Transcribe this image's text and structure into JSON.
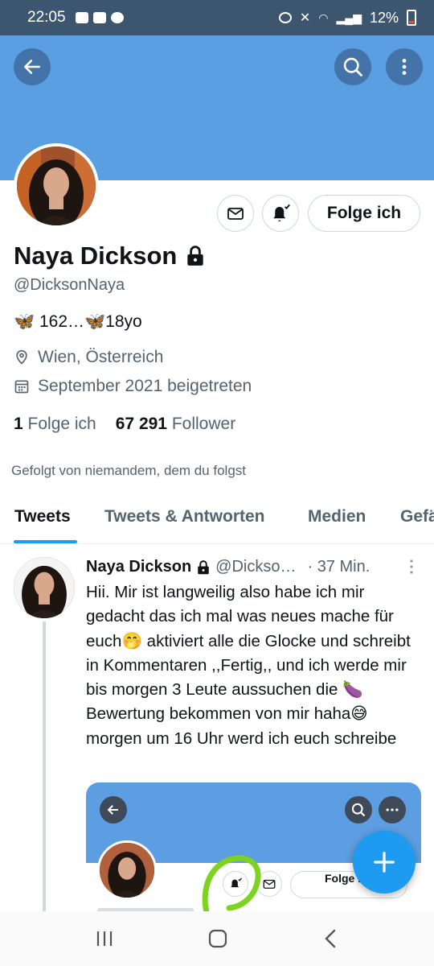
{
  "status_bar": {
    "time": "22:05",
    "battery": "12%"
  },
  "header": {
    "back_icon": "arrow-left-icon",
    "search_icon": "search-icon",
    "more_icon": "more-vertical-icon",
    "banner_color": "#5b9fe3"
  },
  "profile": {
    "name": "Naya Dickson",
    "handle": "@DicksonNaya",
    "bio": "🦋 162…🦋18yo",
    "location": "Wien, Österreich",
    "joined": "September 2021 beigetreten",
    "following_count": "1",
    "following_label": "Folge ich",
    "followers_count": "67 291",
    "followers_label": "Follower",
    "followed_by": "Gefolgt von niemandem, dem du folgst",
    "follow_button": "Folge ich"
  },
  "tabs": [
    {
      "label": "Tweets"
    },
    {
      "label": "Tweets & Antworten"
    },
    {
      "label": "Medien"
    },
    {
      "label": "Gefä"
    }
  ],
  "tweet": {
    "name": "Naya Dickson",
    "handle": "@Dickso…",
    "time": "· 37 Min.",
    "text": "Hii. Mir ist langweilig also habe ich mir gedacht das ich mal was neues mache für euch🤭 aktiviert alle die Glocke und schreibt in Kommentaren ,,Fertig,,  und ich werde mir bis morgen 3 Leute aussuchen die 🍆Bewertung bekommen von mir haha😅morgen um 16 Uhr werd ich euch schreibe",
    "media": {
      "follow_button": "Folge ic"
    }
  },
  "colors": {
    "accent": "#1d9bf0",
    "highlight_circle": "#7ed321"
  }
}
